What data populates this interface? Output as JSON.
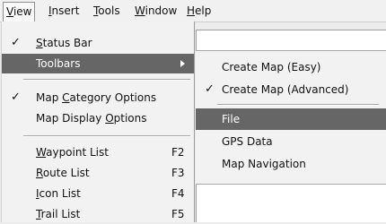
{
  "menubar": {
    "items": [
      {
        "pre": "",
        "mnemonic": "V",
        "post": "iew"
      },
      {
        "pre": "",
        "mnemonic": "I",
        "post": "nsert"
      },
      {
        "pre": "",
        "mnemonic": "T",
        "post": "ools"
      },
      {
        "pre": "",
        "mnemonic": "W",
        "post": "indow"
      },
      {
        "pre": "",
        "mnemonic": "H",
        "post": "elp"
      }
    ]
  },
  "view_menu": {
    "items": [
      {
        "checked": "✓",
        "pre": "",
        "mnemonic": "S",
        "post": "tatus Bar",
        "accel": ""
      },
      {
        "checked": "",
        "pre": "Toolbars",
        "mnemonic": "",
        "post": "",
        "accel": "",
        "submenu": true
      },
      {
        "checked": "✓",
        "pre": "Map ",
        "mnemonic": "C",
        "post": "ategory Options",
        "accel": ""
      },
      {
        "checked": "",
        "pre": "Map Display ",
        "mnemonic": "O",
        "post": "ptions",
        "accel": ""
      },
      {
        "checked": "",
        "pre": "",
        "mnemonic": "W",
        "post": "aypoint List",
        "accel": "F2"
      },
      {
        "checked": "",
        "pre": "",
        "mnemonic": "R",
        "post": "oute List",
        "accel": "F3"
      },
      {
        "checked": "",
        "pre": "",
        "mnemonic": "I",
        "post": "con List",
        "accel": "F4"
      },
      {
        "checked": "",
        "pre": "",
        "mnemonic": "T",
        "post": "rail List",
        "accel": "F5"
      }
    ]
  },
  "toolbars_submenu": {
    "items": [
      {
        "checked": "",
        "label": "Create Map (Easy)"
      },
      {
        "checked": "✓",
        "label": "Create Map (Advanced)"
      },
      {
        "checked": "",
        "label": "File"
      },
      {
        "checked": "",
        "label": "GPS Data"
      },
      {
        "checked": "",
        "label": "Map Navigation"
      }
    ]
  }
}
